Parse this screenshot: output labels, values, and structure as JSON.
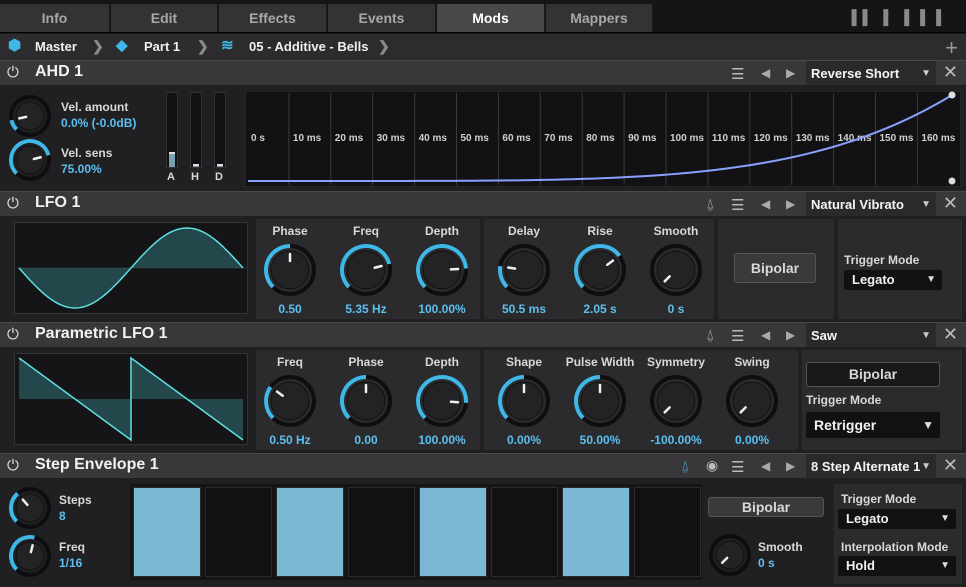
{
  "tabs": [
    {
      "label": "Info"
    },
    {
      "label": "Edit"
    },
    {
      "label": "Effects"
    },
    {
      "label": "Events"
    },
    {
      "label": "Mods"
    },
    {
      "label": "Mappers"
    }
  ],
  "breadcrumb": {
    "master": "Master",
    "part": "Part 1",
    "program": "05 - Additive - Bells"
  },
  "ahd": {
    "title": "AHD 1",
    "preset": "Reverse Short",
    "vel_amount_label": "Vel. amount",
    "vel_amount_value": "0.0% (-0.0dB)",
    "vel_sens_label": "Vel. sens",
    "vel_sens_value": "75.00%",
    "sliders": [
      {
        "label": "A",
        "level": 0.2
      },
      {
        "label": "H",
        "level": 0.0
      },
      {
        "label": "D",
        "level": 0.0
      }
    ],
    "time_ticks": [
      "0 s",
      "10 ms",
      "20 ms",
      "30 ms",
      "40 ms",
      "50 ms",
      "60 ms",
      "70 ms",
      "80 ms",
      "90 ms",
      "100 ms",
      "110 ms",
      "120 ms",
      "130 ms",
      "140 ms",
      "150 ms",
      "160 ms"
    ]
  },
  "lfo": {
    "title": "LFO 1",
    "preset": "Natural Vibrato",
    "knobs": [
      {
        "label": "Phase",
        "value": "0.50",
        "level": 0.5
      },
      {
        "label": "Freq",
        "value": "5.35 Hz",
        "level": 0.78
      },
      {
        "label": "Depth",
        "value": "100.00%",
        "level": 0.82
      },
      {
        "label": "Delay",
        "value": "50.5 ms",
        "level": 0.2
      },
      {
        "label": "Rise",
        "value": "2.05 s",
        "level": 0.7
      },
      {
        "label": "Smooth",
        "value": "0 s",
        "level": 0.0
      }
    ],
    "bipolar": "Bipolar",
    "trigger_label": "Trigger Mode",
    "trigger_value": "Legato"
  },
  "plfo": {
    "title": "Parametric LFO 1",
    "preset": "Saw",
    "knobs": [
      {
        "label": "Freq",
        "value": "0.50 Hz",
        "level": 0.3
      },
      {
        "label": "Phase",
        "value": "0.00",
        "level": 0.5
      },
      {
        "label": "Depth",
        "value": "100.00%",
        "level": 0.85
      },
      {
        "label": "Shape",
        "value": "0.00%",
        "level": 0.5
      },
      {
        "label": "Pulse Width",
        "value": "50.00%",
        "level": 0.5
      },
      {
        "label": "Symmetry",
        "value": "-100.00%",
        "level": 0.0
      },
      {
        "label": "Swing",
        "value": "0.00%",
        "level": 0.0
      }
    ],
    "bipolar": "Bipolar",
    "trigger_label": "Trigger Mode",
    "trigger_value": "Retrigger"
  },
  "step": {
    "title": "Step Envelope 1",
    "preset": "8 Step Alternate 1",
    "steps_label": "Steps",
    "steps_value": "8",
    "freq_label": "Freq",
    "freq_value": "1/16",
    "bars": [
      1,
      0,
      1,
      0,
      1,
      0,
      1,
      0
    ],
    "bipolar": "Bipolar",
    "smooth_label": "Smooth",
    "smooth_value": "0 s",
    "trigger_label": "Trigger Mode",
    "trigger_value": "Legato",
    "interp_label": "Interpolation Mode",
    "interp_value": "Hold"
  },
  "colors": {
    "accent": "#3fb8e8",
    "value": "#5cc0f0",
    "bar": "#7ab8d4",
    "curve": "#8aa0ff"
  }
}
